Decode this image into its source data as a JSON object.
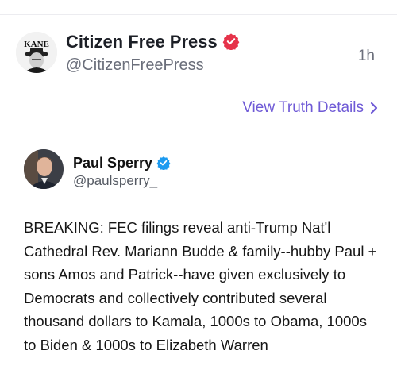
{
  "post": {
    "display_name": "Citizen Free Press",
    "handle": "@CitizenFreePress",
    "timestamp": "1h",
    "avatar_text": "KANE"
  },
  "actions": {
    "view_details_label": "View Truth Details"
  },
  "quoted": {
    "display_name": "Paul Sperry",
    "handle": "@paulsperry_",
    "text": "BREAKING: FEC filings reveal anti-Trump Nat'l Cathedral Rev. Mariann Budde & family--hubby Paul + sons Amos and Patrick--have given exclusively to Democrats and collectively contributed several thousand dollars to Kamala, 1000s to Obama, 1000s to Biden & 1000s to Elizabeth Warren"
  },
  "colors": {
    "accent": "#6f5ad6",
    "verified_red": "#e6334a",
    "verified_blue": "#1d9bf0",
    "muted_text": "#6b6f7b"
  },
  "icons": [
    "verified-badge-red-icon",
    "verified-badge-blue-icon",
    "chevron-right-icon"
  ]
}
